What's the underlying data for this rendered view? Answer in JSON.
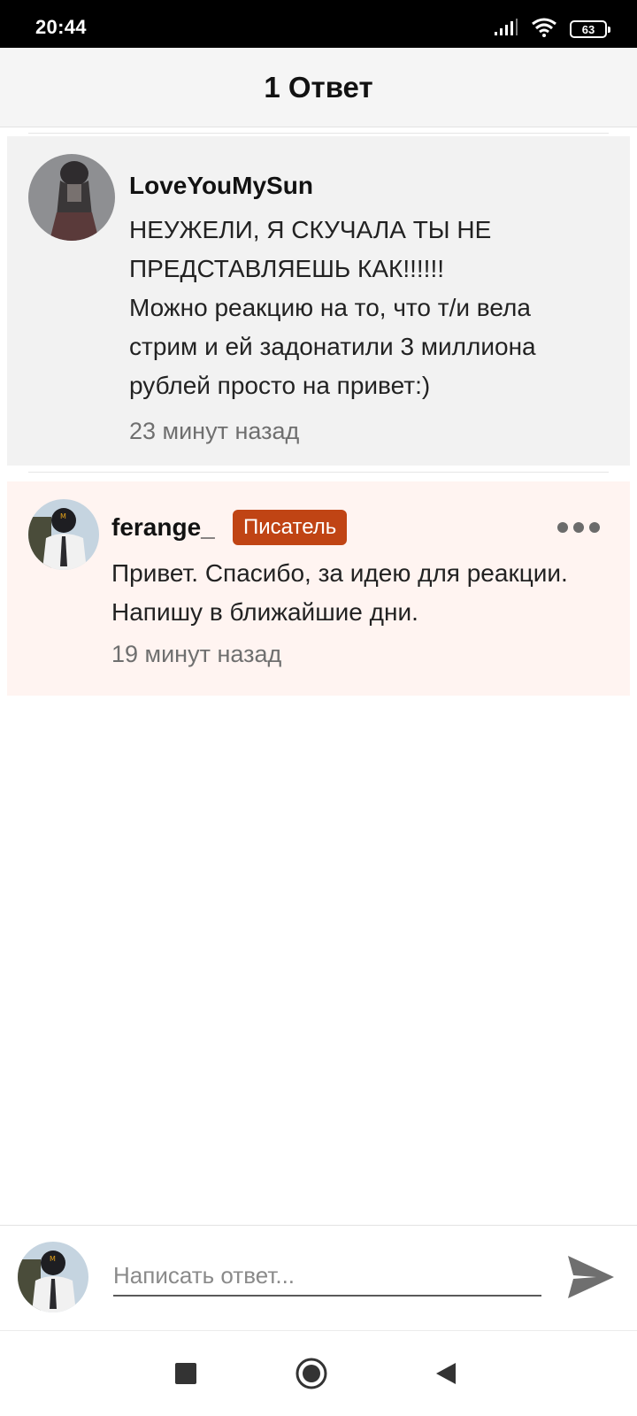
{
  "status_bar": {
    "time": "20:44",
    "battery": "63",
    "icons": [
      "signal-icon",
      "wifi-icon",
      "battery-icon"
    ]
  },
  "header": {
    "title": "1 Ответ"
  },
  "parent_comment": {
    "username": "LoveYouMySun",
    "text_lines": [
      "НЕУЖЕЛИ, Я СКУЧАЛА ТЫ НЕ",
      "ПРЕДСТАВЛЯЕШЬ КАК!!!!!!",
      "Можно реакцию на то, что т/и вела",
      "стрим и ей задонатили 3 миллиона",
      "рублей просто на привет:)"
    ],
    "timestamp": "23 минут назад"
  },
  "reply_comment": {
    "username": "ferange_",
    "badge": "Писатель",
    "text_lines": [
      "Привет. Спасибо, за идею для реакции.",
      "Напишу в ближайшие дни."
    ],
    "timestamp": "19 минут назад"
  },
  "composer": {
    "placeholder": "Написать ответ..."
  },
  "colors": {
    "badge": "#c04414",
    "reply_bg": "#fff4f1",
    "parent_bg": "#f2f2f2",
    "header_bg": "#f5f5f5"
  }
}
